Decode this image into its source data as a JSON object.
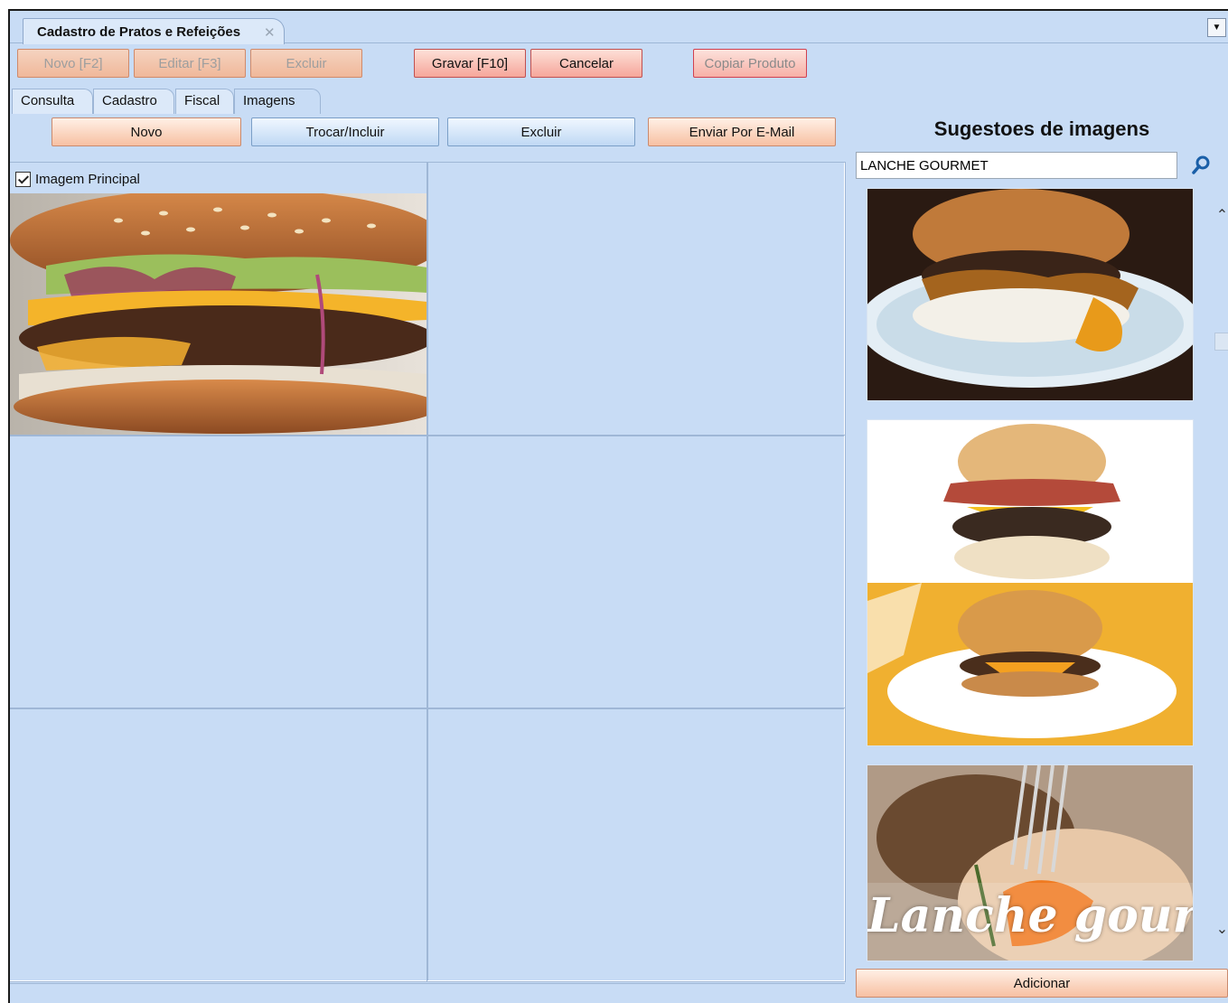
{
  "window": {
    "tab_title": "Cadastro de Pratos e Refeições",
    "close_glyph": "✕",
    "dropdown_glyph": "▼"
  },
  "toolbar": {
    "novo": "Novo [F2]",
    "editar": "Editar [F3]",
    "excluir": "Excluir",
    "gravar": "Gravar [F10]",
    "cancelar": "Cancelar",
    "copiar": "Copiar Produto"
  },
  "tabs": [
    {
      "label": "Consulta"
    },
    {
      "label": "Cadastro"
    },
    {
      "label": "Fiscal"
    },
    {
      "label": "Imagens",
      "active": true
    }
  ],
  "image_actions": {
    "novo": "Novo",
    "trocar": "Trocar/Incluir",
    "excluir": "Excluir",
    "enviar": "Enviar Por E-Mail"
  },
  "image_grid": {
    "main_checkbox_label": "Imagem Principal",
    "main_checked": true
  },
  "suggestions": {
    "title": "Sugestoes de imagens",
    "search_value": "LANCHE GOURMET",
    "thumb_overlay_text": "Lanche gourmet:",
    "add_button": "Adicionar"
  },
  "scroll": {
    "up_glyph": "⌃",
    "down_glyph": "⌄"
  }
}
